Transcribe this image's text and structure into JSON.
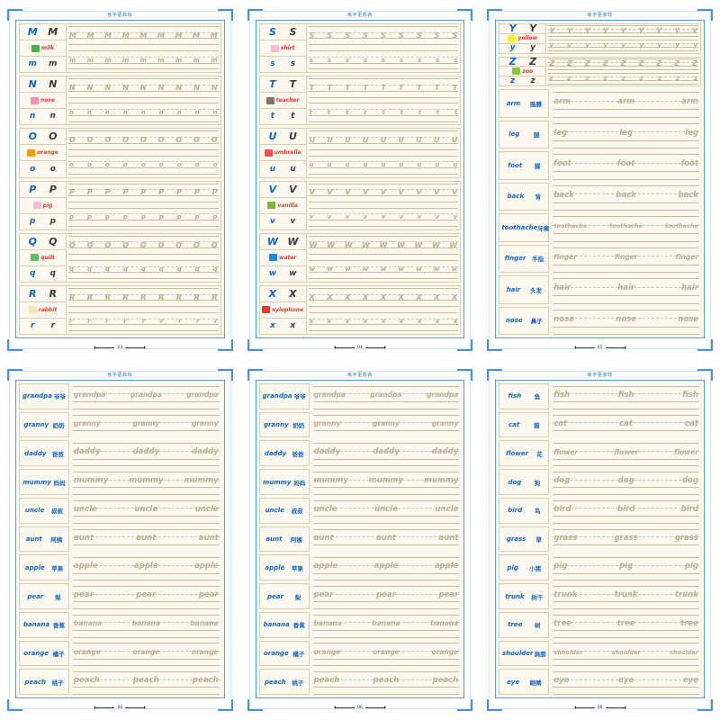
{
  "doc": {
    "header_title": "练字更高效",
    "sheet_bg": "#fbf8ef",
    "border_blue": "#5b9bd5",
    "letter_blue": "#1565c0",
    "word_red": "#e53935",
    "trace_gray": "#b7ae93"
  },
  "pages": [
    {
      "id": "page-03",
      "title": "练字更高效",
      "page_number": "03",
      "kind": "letters",
      "blocks": [
        {
          "upper": "M",
          "upper2": "M",
          "lower": "m",
          "lower2": "m",
          "word": "milk",
          "pic": "milk-icon",
          "pic_color": "#4caf50",
          "upper_repeat": "M",
          "lower_repeat": "m",
          "count": 9
        },
        {
          "upper": "N",
          "upper2": "N",
          "lower": "n",
          "lower2": "n",
          "word": "nose",
          "pic": "nose-icon",
          "pic_color": "#f48fb1",
          "upper_repeat": "N",
          "lower_repeat": "n",
          "count": 9
        },
        {
          "upper": "O",
          "upper2": "O",
          "lower": "o",
          "lower2": "o",
          "word": "orange",
          "pic": "orange-icon",
          "pic_color": "#ff9800",
          "upper_repeat": "O",
          "lower_repeat": "o",
          "count": 9
        },
        {
          "upper": "P",
          "upper2": "P",
          "lower": "p",
          "lower2": "p",
          "word": "pig",
          "pic": "pig-icon",
          "pic_color": "#f8bbd0",
          "upper_repeat": "P",
          "lower_repeat": "p",
          "count": 9
        },
        {
          "upper": "Q",
          "upper2": "Q",
          "lower": "q",
          "lower2": "q",
          "word": "quilt",
          "pic": "quilt-icon",
          "pic_color": "#66bb6a",
          "upper_repeat": "Q",
          "lower_repeat": "q",
          "count": 9
        },
        {
          "upper": "R",
          "upper2": "R",
          "lower": "r",
          "lower2": "r",
          "word": "rabbit",
          "pic": "rabbit-icon",
          "pic_color": "#ffe0b2",
          "upper_repeat": "R",
          "lower_repeat": "r",
          "count": 9
        }
      ]
    },
    {
      "id": "page-04",
      "title": "练字更高效",
      "page_number": "04",
      "kind": "letters",
      "blocks": [
        {
          "upper": "S",
          "upper2": "S",
          "lower": "s",
          "lower2": "s",
          "word": "shirt",
          "pic": "shirt-icon",
          "pic_color": "#f8bbd0",
          "upper_repeat": "S",
          "lower_repeat": "s",
          "count": 9
        },
        {
          "upper": "T",
          "upper2": "T",
          "lower": "t",
          "lower2": "t",
          "word": "teacher",
          "pic": "teacher-icon",
          "pic_color": "#8d6e63",
          "upper_repeat": "T",
          "lower_repeat": "t",
          "count": 9
        },
        {
          "upper": "U",
          "upper2": "U",
          "lower": "u",
          "lower2": "u",
          "word": "umbrella",
          "pic": "umbrella-icon",
          "pic_color": "#ef5350",
          "upper_repeat": "U",
          "lower_repeat": "u",
          "count": 9
        },
        {
          "upper": "V",
          "upper2": "V",
          "lower": "v",
          "lower2": "v",
          "word": "vanilla",
          "pic": "vanilla-icon",
          "pic_color": "#7cb342",
          "upper_repeat": "V",
          "lower_repeat": "v",
          "count": 9
        },
        {
          "upper": "W",
          "upper2": "W",
          "lower": "w",
          "lower2": "w",
          "word": "water",
          "pic": "water-icon",
          "pic_color": "#1e88e5",
          "upper_repeat": "W",
          "lower_repeat": "w",
          "count": 9
        },
        {
          "upper": "X",
          "upper2": "X",
          "lower": "x",
          "lower2": "x",
          "word": "xylophone",
          "pic": "xylophone-icon",
          "pic_color": "#e53935",
          "upper_repeat": "X",
          "lower_repeat": "x",
          "count": 9
        }
      ]
    },
    {
      "id": "page-05",
      "title": "练字更高效",
      "page_number": "05",
      "kind": "mixed",
      "blocks": [
        {
          "upper": "Y",
          "upper2": "Y",
          "lower": "y",
          "lower2": "y",
          "word": "yellow",
          "pic": "yellow-icon",
          "pic_color": "#ffeb3b",
          "upper_repeat": "Y",
          "lower_repeat": "y",
          "count": 9
        },
        {
          "upper": "Z",
          "upper2": "Z",
          "lower": "z",
          "lower2": "z",
          "word": "zoo",
          "pic": "zoo-icon",
          "pic_color": "#8bc34a",
          "upper_repeat": "Z",
          "lower_repeat": "z",
          "count": 9
        }
      ],
      "words": [
        {
          "en": "arm",
          "cn": "胳膊",
          "trace": "arm",
          "reps": 3
        },
        {
          "en": "leg",
          "cn": "腿",
          "trace": "leg",
          "reps": 3
        },
        {
          "en": "foot",
          "cn": "脚",
          "trace": "foot",
          "reps": 3
        },
        {
          "en": "back",
          "cn": "背",
          "trace": "back",
          "reps": 3
        },
        {
          "en": "toothache",
          "cn": "牙痛",
          "trace": "toothache",
          "reps": 3
        },
        {
          "en": "finger",
          "cn": "手指",
          "trace": "finger",
          "reps": 3
        },
        {
          "en": "hair",
          "cn": "头发",
          "trace": "hair",
          "reps": 3
        },
        {
          "en": "nose",
          "cn": "鼻子",
          "trace": "nose",
          "reps": 3
        }
      ]
    },
    {
      "id": "page-06",
      "title": "练字更高效",
      "page_number": "06",
      "kind": "words",
      "words": [
        {
          "en": "grandpa",
          "cn": "爷爷",
          "trace": "grandpa",
          "reps": 3
        },
        {
          "en": "granny",
          "cn": "奶奶",
          "trace": "granny",
          "reps": 3
        },
        {
          "en": "daddy",
          "cn": "爸爸",
          "trace": "daddy",
          "reps": 3
        },
        {
          "en": "mummy",
          "cn": "妈妈",
          "trace": "mummy",
          "reps": 3
        },
        {
          "en": "uncle",
          "cn": "叔叔",
          "trace": "uncle",
          "reps": 3
        },
        {
          "en": "aunt",
          "cn": "阿姨",
          "trace": "aunt",
          "reps": 3
        },
        {
          "en": "apple",
          "cn": "苹果",
          "trace": "apple",
          "reps": 3
        },
        {
          "en": "pear",
          "cn": "梨",
          "trace": "pear",
          "reps": 3
        },
        {
          "en": "banana",
          "cn": "香蕉",
          "trace": "banana",
          "reps": 3
        },
        {
          "en": "orange",
          "cn": "橘子",
          "trace": "orange",
          "reps": 3
        },
        {
          "en": "peach",
          "cn": "桃子",
          "trace": "peach",
          "reps": 3
        }
      ]
    },
    {
      "id": "page-06b",
      "title": "练字更高效",
      "page_number": "06",
      "kind": "words",
      "words": [
        {
          "en": "grandpa",
          "cn": "爷爷",
          "trace": "grandpa",
          "reps": 3
        },
        {
          "en": "granny",
          "cn": "奶奶",
          "trace": "granny",
          "reps": 3
        },
        {
          "en": "daddy",
          "cn": "爸爸",
          "trace": "daddy",
          "reps": 3
        },
        {
          "en": "mummy",
          "cn": "妈妈",
          "trace": "mummy",
          "reps": 3
        },
        {
          "en": "uncle",
          "cn": "叔叔",
          "trace": "uncle",
          "reps": 3
        },
        {
          "en": "aunt",
          "cn": "阿姨",
          "trace": "aunt",
          "reps": 3
        },
        {
          "en": "apple",
          "cn": "苹果",
          "trace": "apple",
          "reps": 3
        },
        {
          "en": "pear",
          "cn": "梨",
          "trace": "pear",
          "reps": 3
        },
        {
          "en": "banana",
          "cn": "香蕉",
          "trace": "banana",
          "reps": 3
        },
        {
          "en": "orange",
          "cn": "橘子",
          "trace": "orange",
          "reps": 3
        },
        {
          "en": "peach",
          "cn": "桃子",
          "trace": "peach",
          "reps": 3
        }
      ]
    },
    {
      "id": "page-08",
      "title": "练字更高效",
      "page_number": "08",
      "kind": "words",
      "words": [
        {
          "en": "fish",
          "cn": "鱼",
          "trace": "fish",
          "reps": 3
        },
        {
          "en": "cat",
          "cn": "猫",
          "trace": "cat",
          "reps": 3
        },
        {
          "en": "flower",
          "cn": "花",
          "trace": "flower",
          "reps": 3
        },
        {
          "en": "dog",
          "cn": "狗",
          "trace": "dog",
          "reps": 3
        },
        {
          "en": "bird",
          "cn": "鸟",
          "trace": "bird",
          "reps": 3
        },
        {
          "en": "grass",
          "cn": "草",
          "trace": "grass",
          "reps": 3
        },
        {
          "en": "pig",
          "cn": "小猪",
          "trace": "pig",
          "reps": 3
        },
        {
          "en": "trunk",
          "cn": "树干",
          "trace": "trunk",
          "reps": 3
        },
        {
          "en": "tree",
          "cn": "树",
          "trace": "tree",
          "reps": 3
        },
        {
          "en": "shoulder",
          "cn": "肩膀",
          "trace": "shoulder",
          "reps": 3
        },
        {
          "en": "eye",
          "cn": "眼睛",
          "trace": "eye",
          "reps": 3
        }
      ]
    }
  ]
}
